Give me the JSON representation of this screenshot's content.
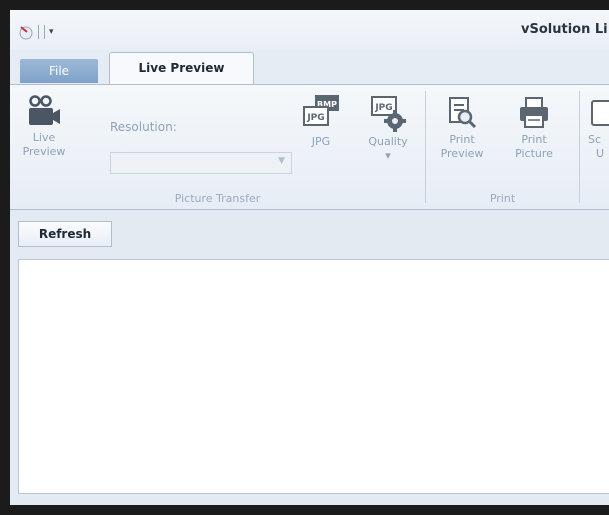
{
  "window": {
    "title": "vSolution Li"
  },
  "tabs": {
    "file": "File",
    "live_preview": "Live Preview"
  },
  "ribbon": {
    "live_preview_btn": {
      "line1": "Live",
      "line2": "Preview"
    },
    "resolution_label": "Resolution:",
    "resolution_value": "",
    "jpg_btn": "JPG",
    "quality_btn": "Quality",
    "quality_arrow": "▾",
    "picture_transfer_label": "Picture Transfer",
    "print_preview_btn": {
      "line1": "Print",
      "line2": "Preview"
    },
    "print_picture_btn": {
      "line1": "Print",
      "line2": "Picture"
    },
    "print_label": "Print",
    "partial_btn": {
      "line1": "Sc",
      "line2": "U"
    }
  },
  "content": {
    "refresh_label": "Refresh"
  },
  "icons": {
    "app": "app-logo-icon",
    "video": "video-camera-icon",
    "bmp_jpg": "bmp-to-jpg-icon",
    "jpg_gear": "jpg-quality-gear-icon",
    "print_preview": "print-preview-icon",
    "printer": "printer-icon"
  },
  "colors": {
    "ribbon_text_disabled": "#8ea2b8",
    "file_tab": "#8fb0d4",
    "accent": "#1f2a36"
  }
}
